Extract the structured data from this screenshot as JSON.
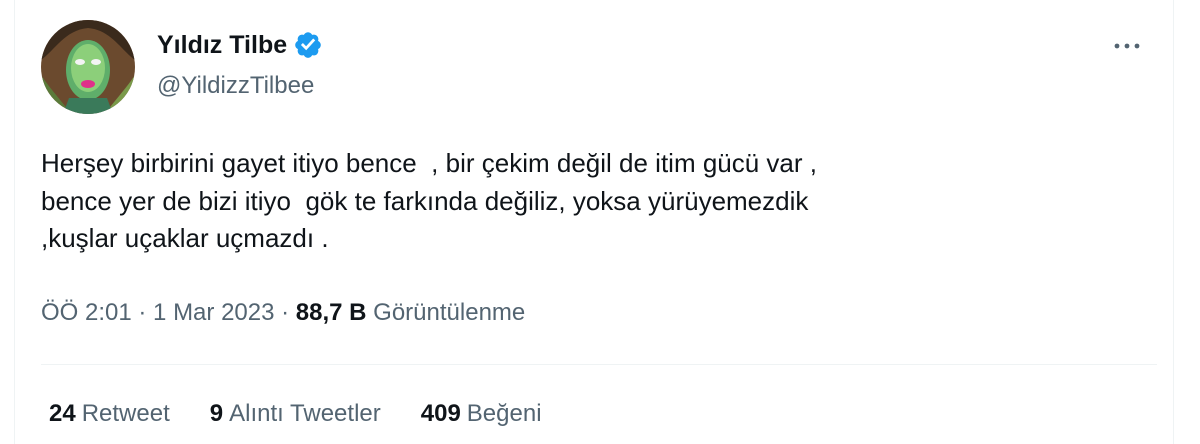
{
  "author": {
    "name": "Yıldız Tilbe",
    "handle": "@YildizzTilbee",
    "verified_icon": "verified-badge-icon",
    "verified_color": "#1d9bf0"
  },
  "more_icon": "more-options-icon",
  "tweet": {
    "lines": [
      "Herşey birbirini gayet itiyo bence  , bir çekim değil de itim gücü var ,",
      "bence yer de bizi itiyo  gök te farkında değiliz, yoksa yürüyemezdik",
      ",kuşlar uçaklar uçmazdı ."
    ]
  },
  "meta": {
    "time": "ÖÖ 2:01",
    "sep1": " · ",
    "date": "1 Mar 2023",
    "sep2": " · ",
    "views_count": "88,7 B",
    "views_label": " Görüntülenme"
  },
  "stats": [
    {
      "count": "24",
      "label": "Retweet"
    },
    {
      "count": "9",
      "label": "Alıntı Tweetler"
    },
    {
      "count": "409",
      "label": "Beğeni"
    }
  ]
}
